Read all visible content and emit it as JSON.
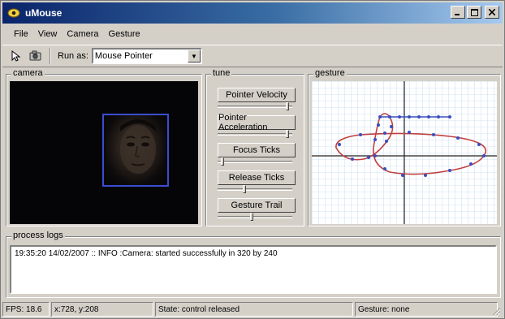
{
  "window": {
    "title": "uMouse"
  },
  "menu": [
    "File",
    "View",
    "Camera",
    "Gesture"
  ],
  "toolbar": {
    "run_as_label": "Run as:",
    "run_as_value": "Mouse Pointer"
  },
  "camera": {
    "label": "camera"
  },
  "tune": {
    "label": "tune",
    "sliders": [
      {
        "label": "Pointer Velocity",
        "value": 0.95
      },
      {
        "label": "Pointer Acceleration",
        "value": 0.95
      },
      {
        "label": "Focus Ticks",
        "value": 0.05
      },
      {
        "label": "Release Ticks",
        "value": 0.35
      },
      {
        "label": "Gesture Trail",
        "value": 0.45
      }
    ]
  },
  "gesture": {
    "label": "gesture"
  },
  "logs": {
    "label": "process logs",
    "entries": [
      "19:35:20 14/02/2007 :: INFO :Camera: started successfully in 320 by 240"
    ]
  },
  "status": {
    "fps": "FPS: 18.6",
    "coords": "x:728, y:208",
    "state": "State: control released",
    "gesture": "Gesture: none"
  },
  "colors": {
    "face_box": "#3b4dd0",
    "trail_blue": "#3a4ec0",
    "trail_red": "#c04040",
    "titlebar": "#0a246a"
  }
}
